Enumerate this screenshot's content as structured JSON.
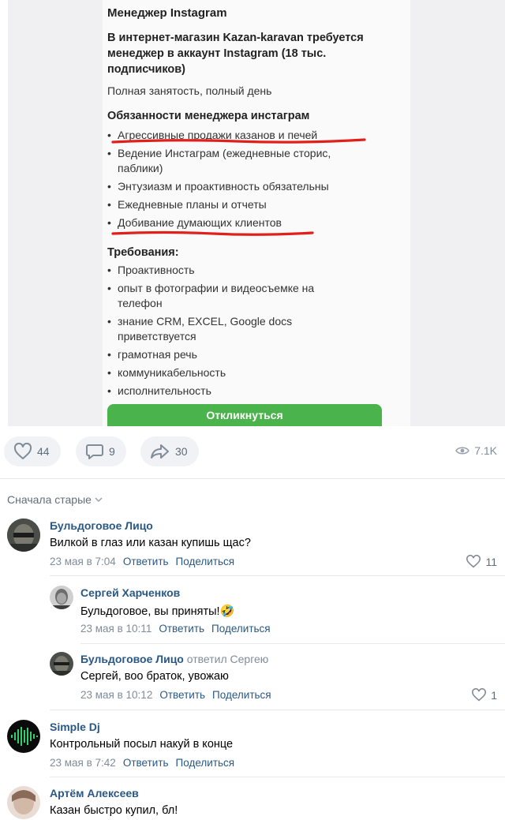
{
  "vacancy": {
    "title": "Менеджер Instagram",
    "subtitle": "В интернет-магазин Kazan-karavan требуется менеджер в аккаунт Instagram (18 тыс. подписчиков)",
    "employment": "Полная занятость, полный день",
    "duties_heading": "Обязанности менеджера инстаграм",
    "duties": [
      "Агрессивные продажи казанов и печей",
      "Ведение Инстаграм (ежедневные сторис, паблики)",
      "Энтузиазм и проактивность обязательны",
      "Ежедневные планы и отчеты",
      "Добивание думающих клиентов"
    ],
    "requirements_heading": "Требования:",
    "requirements": [
      "Проактивность",
      "опыт в фотографии и видеосъемке на телефон",
      "знание CRM, EXCEL, Google docs приветствуется",
      "грамотная речь",
      "коммуникабельность",
      "исполнительность"
    ],
    "apply_label": "Откликнуться",
    "apply_color": "#4bb34b",
    "highlight_color": "#e0201b"
  },
  "actions": {
    "likes": "44",
    "comments": "9",
    "shares": "30",
    "views": "7.1K"
  },
  "comments_section": {
    "sort_label": "Сначала старые",
    "reply_label": "Ответить",
    "share_label": "Поделиться",
    "items": [
      {
        "author": "Бульдоговое Лицо",
        "text": "Вилкой в глаз или казан купишь щас?",
        "time": "23 мая в 7:04",
        "likes": "11"
      },
      {
        "author": "Сергей Харченков",
        "text": "Бульдоговое, вы приняты!",
        "emoji": "🤣",
        "time": "23 мая в 10:11"
      },
      {
        "author": "Бульдоговое Лицо",
        "reply_to": "ответил Сергею",
        "text": "Сергей, воо браток, увожаю",
        "time": "23 мая в 10:12",
        "likes": "1"
      },
      {
        "author": "Simple Dj",
        "text": "Контрольный посыл накуй в конце",
        "time": "23 мая в 7:42"
      },
      {
        "author": "Артём Алексеев",
        "text": "Казан быстро купил, бл!"
      }
    ]
  }
}
